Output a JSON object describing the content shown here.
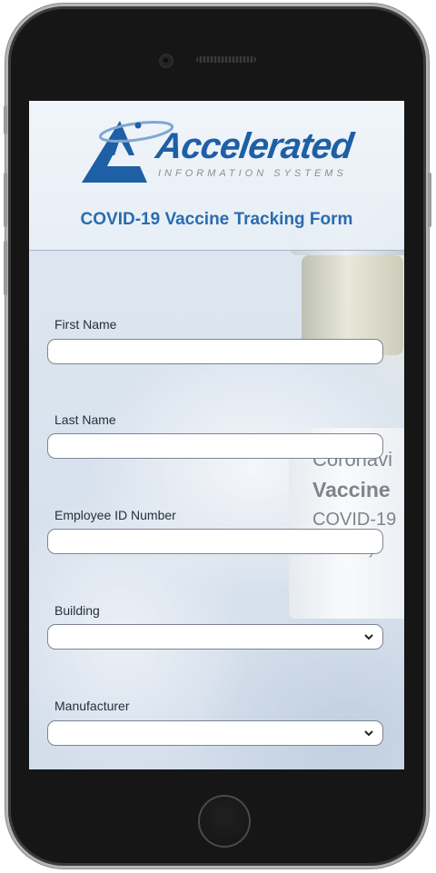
{
  "brand": {
    "name": "Accelerated",
    "tagline": "INFORMATION SYSTEMS"
  },
  "form": {
    "title": "COVID-19 Vaccine Tracking Form",
    "fields": [
      {
        "label": "First Name",
        "value": "",
        "type": "text"
      },
      {
        "label": "Last Name",
        "value": "",
        "type": "text"
      },
      {
        "label": "Employee ID Number",
        "value": "",
        "type": "text"
      },
      {
        "label": "Building",
        "value": "",
        "type": "select"
      },
      {
        "label": "Manufacturer",
        "value": "",
        "type": "select"
      }
    ]
  },
  "background_photo": {
    "vial_lines": [
      "Coronavi",
      "Vaccine",
      "COVID-19",
      "y"
    ]
  },
  "colors": {
    "brand_blue": "#1e5fa5",
    "title_blue": "#2a6cb0",
    "phone_body": "#161616"
  }
}
